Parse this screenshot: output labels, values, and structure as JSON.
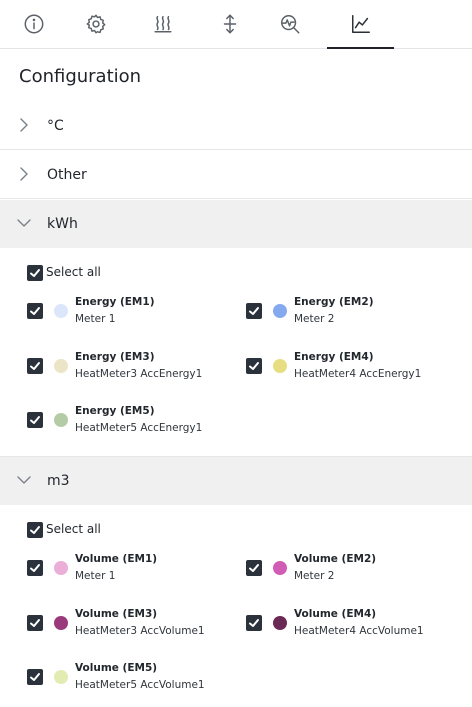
{
  "tabs": [
    {
      "icon": "info-icon",
      "active": false
    },
    {
      "icon": "gear-icon",
      "active": false
    },
    {
      "icon": "heat-icon",
      "active": false
    },
    {
      "icon": "vertical-arrows-icon",
      "active": false
    },
    {
      "icon": "search-activity-icon",
      "active": false
    },
    {
      "icon": "chart-icon",
      "active": true
    }
  ],
  "page_title": "Configuration",
  "sections": [
    {
      "label": "°C",
      "expanded": false
    },
    {
      "label": "Other",
      "expanded": false
    },
    {
      "label": "kWh",
      "expanded": true,
      "select_all_label": "Select all",
      "items": [
        {
          "name": "Energy (EM1)",
          "sub": "Meter 1",
          "color": "#dce6fb",
          "checked": true
        },
        {
          "name": "Energy (EM2)",
          "sub": "Meter 2",
          "color": "#85a9ee",
          "checked": true
        },
        {
          "name": "Energy (EM3)",
          "sub": "HeatMeter3 AccEnergy1",
          "color": "#ece4c6",
          "checked": true
        },
        {
          "name": "Energy (EM4)",
          "sub": "HeatMeter4 AccEnergy1",
          "color": "#e6de80",
          "checked": true
        },
        {
          "name": "Energy (EM5)",
          "sub": "HeatMeter5 AccEnergy1",
          "color": "#b5cba5",
          "checked": true
        }
      ]
    },
    {
      "label": "m3",
      "expanded": true,
      "select_all_label": "Select all",
      "items": [
        {
          "name": "Volume (EM1)",
          "sub": "Meter 1",
          "color": "#eaaed8",
          "checked": true
        },
        {
          "name": "Volume (EM2)",
          "sub": "Meter 2",
          "color": "#d25cb5",
          "checked": true
        },
        {
          "name": "Volume (EM3)",
          "sub": "HeatMeter3 AccVolume1",
          "color": "#9b3a7a",
          "checked": true
        },
        {
          "name": "Volume (EM4)",
          "sub": "HeatMeter4 AccVolume1",
          "color": "#6a2854",
          "checked": true
        },
        {
          "name": "Volume (EM5)",
          "sub": "HeatMeter5 AccVolume1",
          "color": "#e2ebb2",
          "checked": true
        }
      ]
    }
  ]
}
